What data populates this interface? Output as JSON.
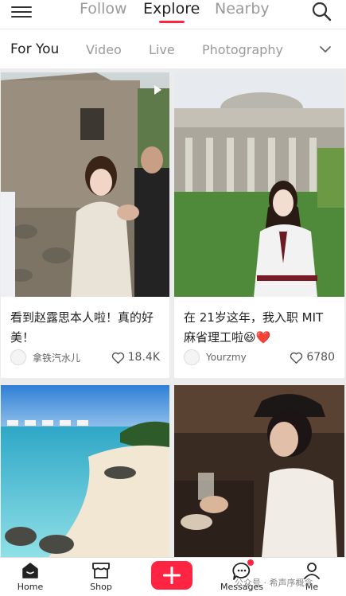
{
  "top_tabs": [
    "Follow",
    "Explore",
    "Nearby"
  ],
  "active_top_tab": "Explore",
  "categories": [
    "For You",
    "Video",
    "Live",
    "Photography"
  ],
  "active_category": "For You",
  "accent_color": "#ff2442",
  "icons": {
    "menu": "hamburger-menu-icon",
    "search": "search-icon",
    "expand": "chevron-down-icon",
    "heart": "heart-outline-icon",
    "video": "play-icon"
  },
  "posts": [
    {
      "title": "看到赵露思本人啦！真的好美！",
      "author": "拿铁汽水儿",
      "likes": "18.4K",
      "media": "video"
    },
    {
      "title": "在 21岁这年，我入职 MIT 麻省理工啦😆❤️",
      "author": "Yourzmy",
      "likes": "6780",
      "media": "image"
    },
    {
      "title": "",
      "author": "",
      "likes": "",
      "media": "image"
    },
    {
      "title": "",
      "author": "",
      "likes": "",
      "media": "image"
    }
  ],
  "bottom_nav": {
    "home": "Home",
    "shop": "Shop",
    "messages": "Messages",
    "me": "Me"
  },
  "watermark": "公众号 · 希声序概念"
}
